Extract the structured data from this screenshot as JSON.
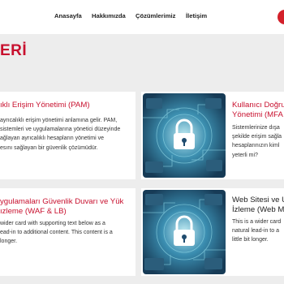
{
  "nav": {
    "items": [
      "Anasayfa",
      "Hakkımızda",
      "Çözümlerimiz",
      "İletişim"
    ]
  },
  "page": {
    "heading": "ERİ"
  },
  "cards": [
    {
      "title_lines": [
        "ıklı Erişim Yönetimi (PAM)"
      ],
      "text_lines": [
        "ayrıcalıklı erişim yönetimi anlamına gelir. PAM,",
        "sistemleri ve uygulamalarına yönetici düzeyinde",
        "ağlayan ayrıcalıklı hesapların yönetimi ve",
        "esını sağlayan bir güvenlik çözümüdür."
      ]
    },
    {
      "title_lines": [
        "Kullanıcı Doğru",
        "Yönetimi (MFA"
      ],
      "text_lines": [
        "Sistemlerinize dışa",
        "şekilde erişim sağla",
        "hesaplarınızın kiml",
        "yeterli mi?"
      ]
    },
    {
      "title_lines": [
        "ygulamaları Güvenlik Duvarı ve Yük",
        "ızleme (WAF & LB)"
      ],
      "text_lines": [
        "wider card with supporting text below as a",
        "ead-in to additional content. This content is a",
        "longer."
      ]
    },
    {
      "title_lines": [
        "Web Sitesi ve U",
        "İzleme (Web M"
      ],
      "text_lines": [
        "This is a wider card",
        "natural lead-in to a",
        "little bit longer."
      ]
    }
  ],
  "colors": {
    "accent": "#c8102e",
    "background": "#ededed",
    "thumb_bg": "#1f4b6e",
    "thumb_glow": "#3fb4c8"
  },
  "icons": {
    "lock": "padlock-icon",
    "brand": "brand-logo-icon"
  }
}
